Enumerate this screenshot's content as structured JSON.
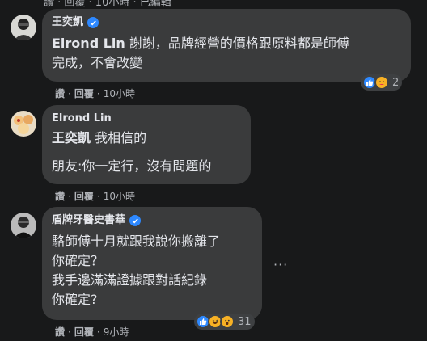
{
  "top_fragment": "讚 · 回覆 · 10小時 · 已編輯",
  "comments": [
    {
      "author": "王奕凱",
      "verified": true,
      "mention": "Elrond Lin",
      "lines": [
        "謝謝，品牌經營的價格跟原料都是師傅",
        "完成，不會改變"
      ],
      "like": "讚",
      "reply": "回覆",
      "time": "10小時",
      "reaction_count": "2"
    },
    {
      "author": "Elrond Lin",
      "verified": false,
      "mention": "王奕凱",
      "lines": [
        "我相信的",
        "朋友:你一定行，沒有問題的"
      ],
      "like": "讚",
      "reply": "回覆",
      "time": "10小時"
    },
    {
      "author": "盾牌牙醫史書華",
      "verified": true,
      "lines": [
        "駱師傅十月就跟我說你搬離了",
        "你確定？",
        "我手邊滿滿證據跟對話紀錄",
        "你確定?"
      ],
      "like": "讚",
      "reply": "回覆",
      "time": "9小時",
      "reaction_count": "31",
      "more_label": "···"
    }
  ],
  "colors": {
    "background": "#18191a",
    "bubble": "#3a3b3c",
    "text": "#e4e6eb",
    "secondary": "#b0b3b8",
    "like_blue": "#2e89ff",
    "verified_blue": "#2d88ff"
  }
}
